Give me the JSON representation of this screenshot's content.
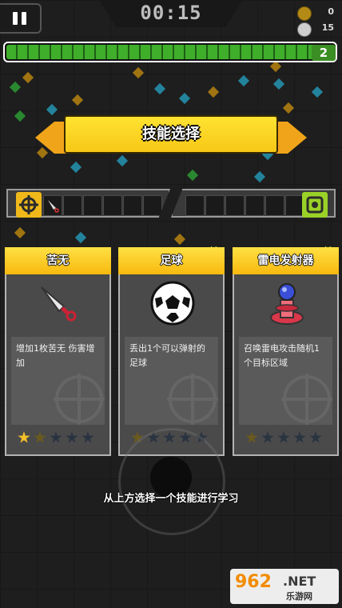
{
  "hud": {
    "timer": "00:15",
    "coins": "0",
    "kills": "15",
    "level": "2",
    "xp_fraction": 0.96
  },
  "banner": {
    "title": "技能选择"
  },
  "skill_bar": {
    "weapon_slots": 5,
    "passive_slots": 6
  },
  "cards": [
    {
      "name": "苦无",
      "description": "增加1枚苦无 伤害增加",
      "icon": "kunai-icon",
      "stars_filled": 1,
      "stars_half": 1,
      "stars_total": 5,
      "new": false
    },
    {
      "name": "足球",
      "description": "丢出1个可以弹射的足球",
      "icon": "soccer-ball-icon",
      "stars_filled": 0,
      "stars_half": 1,
      "stars_total": 5,
      "new": true
    },
    {
      "name": "雷电发射器",
      "description": "召唤雷电攻击随机1个目标区域",
      "icon": "lightning-launcher-icon",
      "stars_filled": 0,
      "stars_half": 1,
      "stars_total": 5,
      "new": true
    }
  ],
  "new_label": "新!",
  "hint": "从上方选择一个技能进行学习",
  "watermark": {
    "number": "962",
    "suffix": ".NET",
    "cn": "乐游网"
  },
  "colors": {
    "accent_yellow": "#f7c716",
    "xp_green": "#3fae2a",
    "card_border": "#b3b3b3",
    "star_gold": "#f2c029",
    "star_dim": "#6b5a1d",
    "star_off": "#2a3340"
  }
}
